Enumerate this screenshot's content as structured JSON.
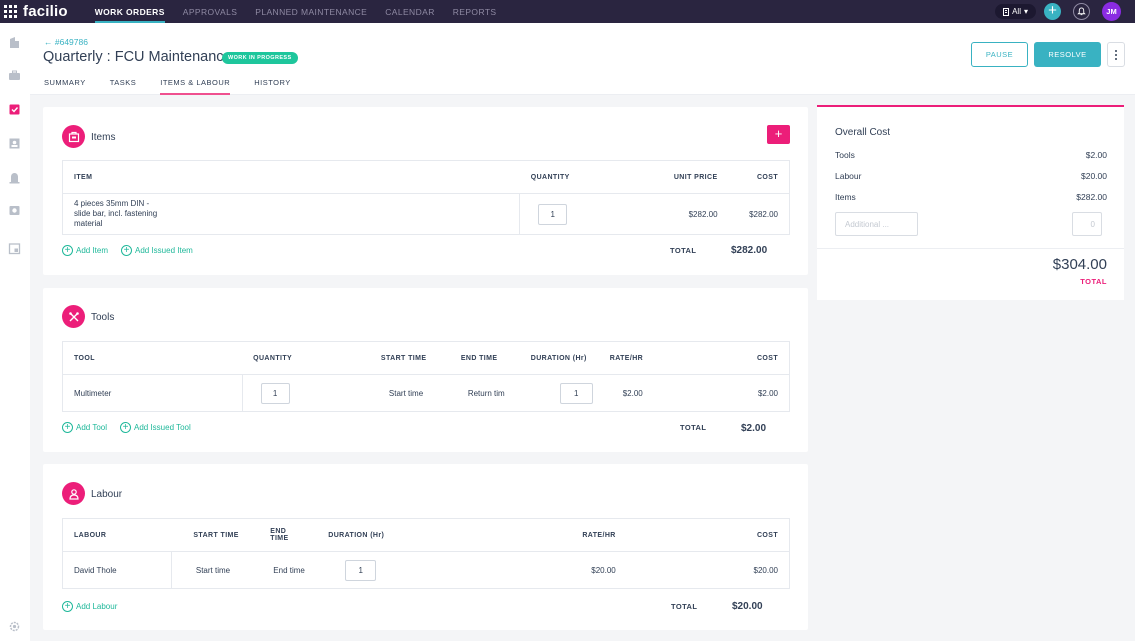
{
  "topnav": {
    "logo": "facilio",
    "tabs": [
      {
        "label": "WORK ORDERS",
        "active": true
      },
      {
        "label": "APPROVALS"
      },
      {
        "label": "PLANNED MAINTENANCE"
      },
      {
        "label": "CALENDAR"
      },
      {
        "label": "REPORTS"
      }
    ],
    "site_select": "All",
    "avatar_initials": "JM",
    "colors": {
      "bg": "#2a2540",
      "accent": "#39b2c2",
      "avatar": "#8a2be2"
    }
  },
  "sidebar": {
    "icons": [
      "building-icon",
      "briefcase-icon",
      "workorder-icon",
      "contacts-icon",
      "alarm-icon",
      "camera-icon",
      "calendar-icon",
      "settings-icon"
    ]
  },
  "header": {
    "back_link": "← #649786",
    "title": "Quarterly : FCU Maintenance",
    "status": "WORK IN PROGRESS",
    "tabs": [
      "SUMMARY",
      "TASKS",
      "ITEMS & LABOUR",
      "HISTORY"
    ],
    "active_tab": "ITEMS & LABOUR",
    "pause_label": "PAUSE",
    "resolve_label": "RESOLVE"
  },
  "items": {
    "title": "Items",
    "add_button": "+",
    "columns": [
      "ITEM",
      "QUANTITY",
      "UNIT PRICE",
      "COST"
    ],
    "rows": [
      {
        "item_lines": [
          "4 pieces 35mm DIN -",
          "slide bar, incl. fastening",
          "material"
        ],
        "quantity": "1",
        "unit_price": "$282.00",
        "cost": "$282.00"
      }
    ],
    "add_item": "Add Item",
    "add_issued_item": "Add Issued Item",
    "total_label": "TOTAL",
    "total_value": "$282.00"
  },
  "tools": {
    "title": "Tools",
    "columns": [
      "TOOL",
      "QUANTITY",
      "START TIME",
      "END TIME",
      "DURATION (Hr)",
      "RATE/HR",
      "COST"
    ],
    "rows": [
      {
        "tool": "Multimeter",
        "quantity": "1",
        "start_placeholder": "Start time",
        "end_placeholder": "Return tim",
        "duration": "1",
        "rate": "$2.00",
        "cost": "$2.00"
      }
    ],
    "add_tool": "Add Tool",
    "add_issued_tool": "Add Issued Tool",
    "total_label": "TOTAL",
    "total_value": "$2.00"
  },
  "labour": {
    "title": "Labour",
    "columns": [
      "LABOUR",
      "START TIME",
      "END TIME",
      "DURATION (Hr)",
      "RATE/HR",
      "COST"
    ],
    "rows": [
      {
        "name": "David Thole",
        "start_placeholder": "Start time",
        "end_placeholder": "End time",
        "duration": "1",
        "rate": "$20.00",
        "cost": "$20.00"
      }
    ],
    "add_labour": "Add Labour",
    "total_label": "TOTAL",
    "total_value": "$20.00"
  },
  "overall": {
    "title": "Overall Cost",
    "rows": [
      {
        "label": "Tools",
        "value": "$2.00"
      },
      {
        "label": "Labour",
        "value": "$20.00"
      },
      {
        "label": "Items",
        "value": "$282.00"
      }
    ],
    "additional_placeholder": "Additional ...",
    "additional_value": "0",
    "total_value": "$304.00",
    "total_label": "TOTAL"
  },
  "colors": {
    "accent_pink": "#ec1e79",
    "accent_teal": "#39b2c2",
    "status_green": "#1ec69c",
    "link_green": "#1fb89a"
  }
}
